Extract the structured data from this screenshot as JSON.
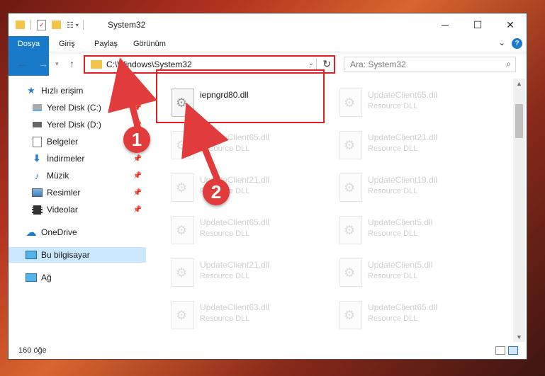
{
  "window": {
    "title": "System32",
    "controls": [
      "minimize",
      "maximize",
      "close"
    ]
  },
  "ribbon": {
    "tabs": [
      {
        "label": "Dosya",
        "active": true
      },
      {
        "label": "Giriş"
      },
      {
        "label": "Paylaş"
      },
      {
        "label": "Görünüm"
      }
    ],
    "help_label": "?"
  },
  "address_bar": {
    "path": "C:\\Windows\\System32",
    "search_placeholder": "Ara: System32"
  },
  "sidebar": {
    "items": [
      {
        "label": "Hızlı erişim",
        "icon": "star-icon",
        "pinned": false
      },
      {
        "label": "Yerel Disk (C:)",
        "icon": "drive-icon",
        "pinned": true
      },
      {
        "label": "Yerel Disk (D:)",
        "icon": "drive-icon",
        "pinned": true
      },
      {
        "label": "Belgeler",
        "icon": "documents-icon",
        "pinned": true
      },
      {
        "label": "İndirmeler",
        "icon": "downloads-icon",
        "pinned": true
      },
      {
        "label": "Müzik",
        "icon": "music-icon",
        "pinned": true
      },
      {
        "label": "Resimler",
        "icon": "pictures-icon",
        "pinned": true
      },
      {
        "label": "Videolar",
        "icon": "videos-icon",
        "pinned": true
      },
      {
        "label": "OneDrive",
        "icon": "cloud-icon",
        "pinned": false
      },
      {
        "label": "Bu bilgisayar",
        "icon": "computer-icon",
        "pinned": false,
        "selected": true
      },
      {
        "label": "Ağ",
        "icon": "network-icon",
        "pinned": false
      }
    ]
  },
  "files": {
    "main": {
      "name": "iepngrd80.dll"
    },
    "ghost": [
      {
        "name": "UpdateClient65.dll",
        "type": "Resource DLL"
      },
      {
        "name": "UpdateClient65.dll",
        "type": "Resource DLL"
      },
      {
        "name": "UpdateClient21.dll",
        "type": "Resource DLL"
      },
      {
        "name": "UpdateClient21.dll",
        "type": "Resource DLL"
      },
      {
        "name": "UpdateClient19.dll",
        "type": "Resource DLL"
      },
      {
        "name": "UpdateClient65.dll",
        "type": "Resource DLL"
      },
      {
        "name": "UpdateClient5.dll",
        "type": "Resource DLL"
      },
      {
        "name": "UpdateClient21.dll",
        "type": "Resource DLL"
      },
      {
        "name": "UpdateClient5.dll",
        "type": "Resource DLL"
      },
      {
        "name": "UpdateClient63.dll",
        "type": "Resource DLL"
      },
      {
        "name": "UpdateClient65.dll",
        "type": "Resource DLL"
      }
    ]
  },
  "status_bar": {
    "count": "160 öğe"
  },
  "annotations": {
    "step1": "1",
    "step2": "2"
  },
  "colors": {
    "accent": "#1979ca",
    "highlight": "#e02020",
    "badge": "#e23b3b"
  }
}
